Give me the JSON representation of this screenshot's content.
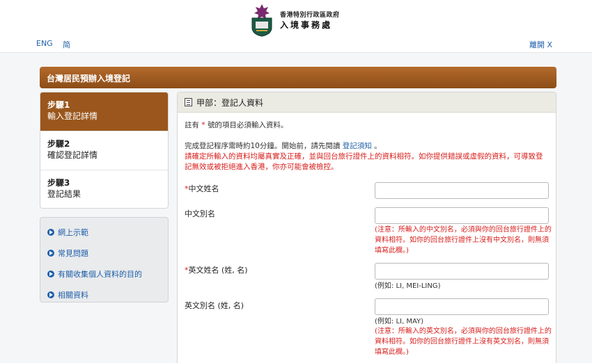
{
  "header": {
    "dept_line1": "香港特別行政區政府",
    "dept_line2": "入境事務處",
    "lang_eng": "ENG",
    "lang_sc": "简",
    "leave": "離開 X"
  },
  "page_title": "台灣居民預辦入境登記",
  "steps": [
    {
      "num": "步驟1",
      "label": "輸入登記詳情",
      "active": true
    },
    {
      "num": "步驟2",
      "label": "確認登記詳情",
      "active": false
    },
    {
      "num": "步驟3",
      "label": "登記結果",
      "active": false
    }
  ],
  "links": [
    "網上示範",
    "常見問題",
    "有關收集個人資料的目的",
    "相關資料"
  ],
  "panel": {
    "title": "甲部：登記人資料",
    "required_note_pre": "註有",
    "required_mark": "*",
    "required_note_post": "號的項目必須輸入資料。",
    "intro_pre": "完成登記程序需時約10分鐘。開始前，請先閱讀",
    "intro_link": "登記須知",
    "intro_post": "。",
    "warning": "請確定所輸入的資料均屬真實及正確，並與回台旅行證件上的資料相符。如你提供錯誤或虛假的資料，可導致登記無效或被拒絕進入香港，你亦可能會被檢控。"
  },
  "fields": {
    "chinese_name": {
      "label": "中文姓名",
      "required": "*",
      "value": ""
    },
    "chinese_alias": {
      "label": "中文別名",
      "value": "",
      "note": "(注意：所輸入的中文別名，必須與你的回台旅行證件上的資料相符。如你的回台旅行證件上沒有中文別名，則無須填寫此欄。)"
    },
    "english_name": {
      "label": "英文姓名 (姓, 名)",
      "required": "*",
      "value": "",
      "example": "(例如: LI, MEI-LING)"
    },
    "english_alias": {
      "label": "英文別名 (姓, 名)",
      "value": "",
      "example": "(例如: LI, MAY)",
      "note": "(注意：所輸入的英文別名，必須與你的回台旅行證件上的資料相符。如你的回台旅行證件上沒有英文別名，則無須填寫此欄。)"
    }
  },
  "colors": {
    "accent_brown": "#9a561c",
    "link_blue": "#1f5fa8",
    "warning_red": "#d7201e"
  }
}
